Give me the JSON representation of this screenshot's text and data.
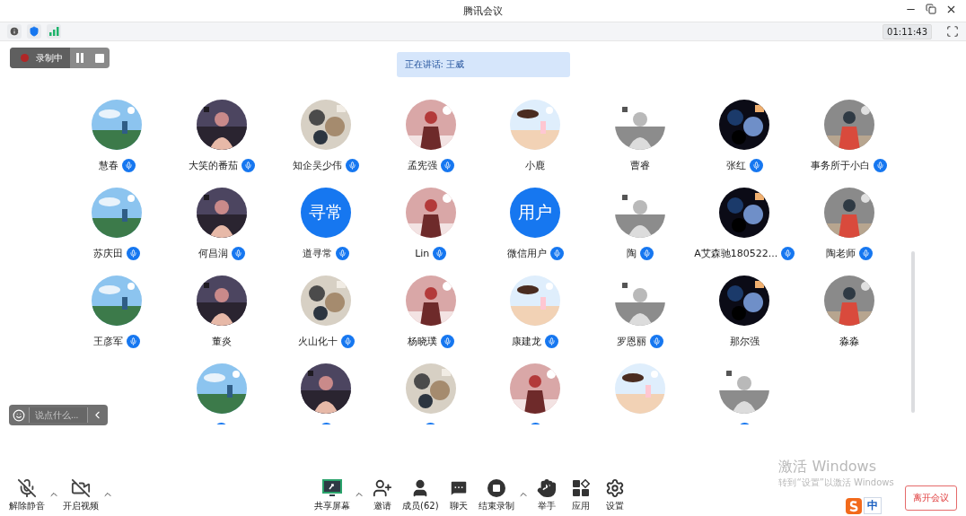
{
  "window": {
    "title": "腾讯会议",
    "timer": "01:11:43"
  },
  "recording": {
    "label": "录制中"
  },
  "speaking": "正在讲话: 王威",
  "participants": [
    {
      "name": "慧春",
      "mic": true
    },
    {
      "name": "大笑的番茄",
      "mic": true
    },
    {
      "name": "知企吴少伟",
      "mic": true
    },
    {
      "name": "孟宪强",
      "mic": true
    },
    {
      "name": "小鹿",
      "mic": false
    },
    {
      "name": "曹睿",
      "mic": false
    },
    {
      "name": "张红",
      "mic": true
    },
    {
      "name": "事务所于小白",
      "mic": true
    },
    {
      "name": "苏庆田",
      "mic": true
    },
    {
      "name": "何昌润",
      "mic": true
    },
    {
      "name": "道寻常",
      "mic": true,
      "avatar": {
        "kind": "text",
        "text": "寻常"
      }
    },
    {
      "name": "Lin",
      "mic": true
    },
    {
      "name": "微信用户",
      "mic": true,
      "avatar": {
        "kind": "text",
        "text": "用户"
      }
    },
    {
      "name": "陶",
      "mic": true
    },
    {
      "name": "A艾森驰180522...",
      "mic": true
    },
    {
      "name": "陶老师",
      "mic": true
    },
    {
      "name": "王彦军",
      "mic": true
    },
    {
      "name": "董炎",
      "mic": false
    },
    {
      "name": "火山化十",
      "mic": true
    },
    {
      "name": "杨晓璞",
      "mic": true
    },
    {
      "name": "康建龙",
      "mic": true
    },
    {
      "name": "罗恩丽",
      "mic": true
    },
    {
      "name": "那尔强",
      "mic": false
    },
    {
      "name": "淼淼",
      "mic": false
    },
    {
      "mic": true
    },
    {
      "mic": true
    },
    {
      "mic": true
    },
    {
      "mic": true
    },
    {
      "mic": false
    },
    {
      "mic": true
    }
  ],
  "chat": {
    "placeholder": "说点什么..."
  },
  "toolbar_left": [
    {
      "kind": "microphone",
      "label": "解除静音",
      "menu": true
    },
    {
      "kind": "camera",
      "label": "开启视频",
      "menu": true
    }
  ],
  "toolbar_center": [
    {
      "kind": "share",
      "label": "共享屏幕",
      "menu": true
    },
    {
      "kind": "invite",
      "label": "邀请",
      "menu": false
    },
    {
      "kind": "members",
      "label": "成员(62)",
      "menu": false
    },
    {
      "kind": "chat",
      "label": "聊天",
      "menu": false
    },
    {
      "kind": "stop",
      "label": "结束录制",
      "menu": true
    },
    {
      "kind": "hand",
      "label": "举手",
      "menu": false
    },
    {
      "kind": "apps",
      "label": "应用",
      "menu": false
    },
    {
      "kind": "settings",
      "label": "设置",
      "menu": false
    }
  ],
  "windows_notice": {
    "title": "激活 Windows",
    "text": "转到“设置”以激活 Windows"
  },
  "ime": {
    "label": "中"
  },
  "leave_button": "离开会议"
}
